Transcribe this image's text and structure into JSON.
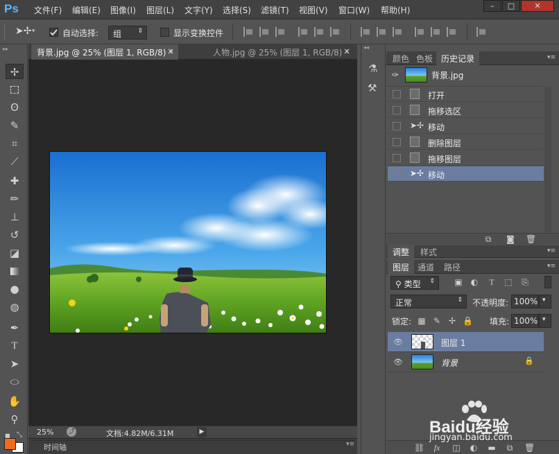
{
  "app": {
    "logo": "Ps"
  },
  "menubar": {
    "items": [
      "文件(F)",
      "编辑(E)",
      "图像(I)",
      "图层(L)",
      "文字(Y)",
      "选择(S)",
      "滤镜(T)",
      "视图(V)",
      "窗口(W)",
      "帮助(H)"
    ],
    "window_buttons": [
      "–",
      "□",
      "✕"
    ]
  },
  "options": {
    "auto_select_label": "自动选择:",
    "auto_select_value": "组",
    "show_transform_label": "显示变换控件"
  },
  "tabs": [
    {
      "label": "背景.jpg @ 25% (图层 1, RGB/8) *",
      "close": "×"
    },
    {
      "label": "人物.jpg @ 25% (图层 1, RGB/8) *",
      "close": "×"
    }
  ],
  "status": {
    "zoom": "25%",
    "doc_info": "文档:4.82M/6.31M"
  },
  "timeline": {
    "label": "时间轴"
  },
  "history_panel": {
    "tabs": [
      "颜色",
      "色板",
      "历史记录"
    ],
    "snapshot": "背景.jpg",
    "items": [
      "打开",
      "拖移选区",
      "移动",
      "删除图层",
      "拖移图层",
      "移动"
    ],
    "selected_index": 5
  },
  "layers_panel": {
    "top_tabs": [
      "调整",
      "样式"
    ],
    "tabs": [
      "图层",
      "通道",
      "路径"
    ],
    "filter_kind": "类型",
    "blend_mode": "正常",
    "opacity_label": "不透明度:",
    "opacity_value": "100%",
    "lock_label": "锁定:",
    "fill_label": "填充:",
    "fill_value": "100%",
    "layers": [
      {
        "name": "图层 1",
        "selected": true
      },
      {
        "name": "背景",
        "selected": false,
        "locked": true
      }
    ]
  },
  "watermark": {
    "brand": "Baidu经验",
    "url": "jingyan.baidu.com"
  },
  "colors": {
    "accent": "#6a7da0",
    "ps_blue": "#5cb6ff",
    "foreground": "#f26b1d",
    "background": "#ffffff"
  }
}
